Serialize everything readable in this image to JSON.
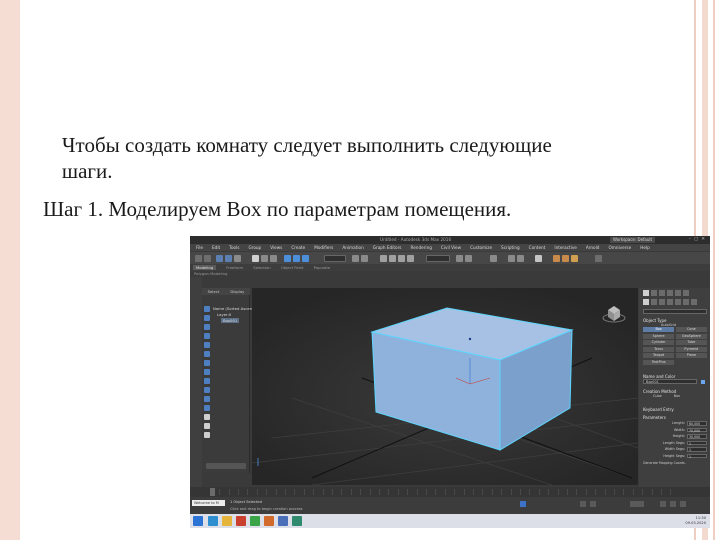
{
  "slide": {
    "bullet_icon": "",
    "bullet_text": "Чтобы создать комнату следует выполнить следующие шаги.",
    "step_text": "Шаг 1. Моделируем Box по параметрам помещения."
  },
  "screenshot": {
    "title": "Untitled - Autodesk 3ds Max 2016",
    "workspace": "Workspace: Default",
    "menu": [
      "File",
      "Edit",
      "Tools",
      "Group",
      "Views",
      "Create",
      "Modifiers",
      "Animation",
      "Graph Editors",
      "Rendering",
      "Civil View",
      "Customize",
      "Scripting",
      "Content",
      "Interactive",
      "Arnold",
      "Omniverse",
      "Help"
    ],
    "ribbon_tabs": [
      "Modeling",
      "Freeform",
      "Selection",
      "Object Paint",
      "Populate"
    ],
    "ribbon_sub": "Polygon Modeling",
    "scene_tabs": [
      "Select",
      "Display"
    ],
    "scene_tree": [
      "Name (Sorted Ascending)",
      "Layer:0",
      "Box001"
    ],
    "viewport_label": "[+] [Perspective ] [Standard ] [Default Shading ]",
    "cmd": {
      "object_type_header": "Object Type",
      "autogrid": "AutoGrid",
      "primitive_buttons": [
        "Box",
        "Cone",
        "Sphere",
        "GeoSphere",
        "Cylinder",
        "Tube",
        "Torus",
        "Pyramid",
        "Teapot",
        "Plane",
        "TextPlus"
      ],
      "name_color_header": "Name and Color",
      "name_value": "Box001",
      "creation_header": "Creation Method",
      "creation_opts": [
        "Cube",
        "Box"
      ],
      "keyboard_header": "Keyboard Entry",
      "params_header": "Parameters",
      "params": [
        {
          "label": "Length:",
          "value": "60,000"
        },
        {
          "label": "Width:",
          "value": "70,000"
        },
        {
          "label": "Height:",
          "value": "30,000"
        },
        {
          "label": "Length Segs:",
          "value": "1"
        },
        {
          "label": "Width Segs:",
          "value": "1"
        },
        {
          "label": "Height Segs:",
          "value": "1"
        }
      ],
      "gen_map": "Generate Mapping Coords."
    },
    "status_maxscript": "Welcome to M",
    "status_line1": "1 Object Selected",
    "status_line2": "Click and drag to begin creation process",
    "clock_time": "11:30",
    "clock_date": "09.03.2020"
  },
  "colors": {
    "accent_bar": "#f6ddd3",
    "box_fill": "#8eb2dc",
    "box_edge": "#5dd6ff"
  }
}
